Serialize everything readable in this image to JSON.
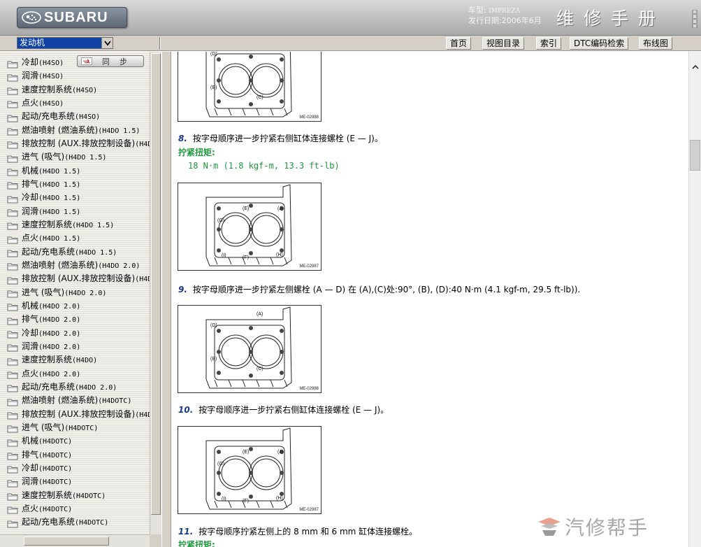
{
  "header": {
    "brand": "SUBARU",
    "model_label": "车型:",
    "model_value": "IMPREZA",
    "date_label": "发行日期:",
    "date_value": "2006年6月",
    "title": "维修手册"
  },
  "toolbar": {
    "section_selected": "发动机",
    "buttons": [
      "首页",
      "视图目录",
      "索引",
      "DTC编码检索",
      "布线图"
    ]
  },
  "sidebar": {
    "sync_label": "同步",
    "items": [
      {
        "name": "冷却",
        "code": "(H4SO)"
      },
      {
        "name": "润滑",
        "code": "(H4SO)"
      },
      {
        "name": "速度控制系统",
        "code": "(H4SO)"
      },
      {
        "name": "点火",
        "code": "(H4SO)"
      },
      {
        "name": "起动/充电系统",
        "code": "(H4SO)"
      },
      {
        "name": "燃油喷射 (燃油系统)",
        "code": "(H4DO 1.5)"
      },
      {
        "name": "排放控制 (AUX.排放控制设备)",
        "code": "(H4D"
      },
      {
        "name": "进气 (吸气)",
        "code": "(H4DO 1.5)"
      },
      {
        "name": "机械",
        "code": "(H4DO 1.5)"
      },
      {
        "name": "排气",
        "code": "(H4DO 1.5)"
      },
      {
        "name": "冷却",
        "code": "(H4DO 1.5)"
      },
      {
        "name": "润滑",
        "code": "(H4DO 1.5)"
      },
      {
        "name": "速度控制系统",
        "code": "(H4DO 1.5)"
      },
      {
        "name": "点火",
        "code": "(H4DO 1.5)"
      },
      {
        "name": "起动/充电系统",
        "code": "(H4DO 1.5)"
      },
      {
        "name": "燃油喷射 (燃油系统)",
        "code": "(H4DO 2.0)"
      },
      {
        "name": "排放控制 (AUX.排放控制设备)",
        "code": "(H4D"
      },
      {
        "name": "进气 (吸气)",
        "code": "(H4DO 2.0)"
      },
      {
        "name": "机械",
        "code": "(H4DO 2.0)"
      },
      {
        "name": "排气",
        "code": "(H4DO 2.0)"
      },
      {
        "name": "冷却",
        "code": "(H4DO 2.0)"
      },
      {
        "name": "润滑",
        "code": "(H4DO 2.0)"
      },
      {
        "name": "速度控制系统",
        "code": "(H4DO)"
      },
      {
        "name": "点火",
        "code": "(H4DO 2.0)"
      },
      {
        "name": "起动/充电系统",
        "code": "(H4DO 2.0)"
      },
      {
        "name": "燃油喷射 (燃油系统)",
        "code": "(H4DOTC)"
      },
      {
        "name": "排放控制 (AUX.排放控制设备)",
        "code": "(H4D"
      },
      {
        "name": "进气 (吸气)",
        "code": "(H4DOTC)"
      },
      {
        "name": "机械",
        "code": "(H4DOTC)"
      },
      {
        "name": "排气",
        "code": "(H4DOTC)"
      },
      {
        "name": "冷却",
        "code": "(H4DOTC)"
      },
      {
        "name": "润滑",
        "code": "(H4DOTC)"
      },
      {
        "name": "速度控制系统",
        "code": "(H4DOTC)"
      },
      {
        "name": "点火",
        "code": "(H4DOTC)"
      },
      {
        "name": "起动/充电系统",
        "code": "(H4DOTC)"
      }
    ]
  },
  "content": {
    "figures": [
      {
        "id": "ME-02988",
        "labels": [
          "(A)",
          "(D)",
          "(B)",
          "(C)"
        ]
      },
      {
        "id": "ME-02987",
        "labels": [
          "(E)",
          "(J)",
          "(G)",
          "(I)",
          "(F)",
          "(H)"
        ]
      },
      {
        "id": "ME-02988",
        "labels": [
          "(A)",
          "(D)",
          "(B)",
          "(C)"
        ]
      },
      {
        "id": "ME-02987",
        "labels": [
          "(E)",
          "(J)",
          "(G)",
          "(I)",
          "(F)",
          "(H)"
        ]
      }
    ],
    "steps": [
      {
        "num": "8.",
        "text": "按字母顺序进一步拧紧右侧缸体连接螺栓 (E — J)。"
      },
      {
        "num": "9.",
        "text": "按字母顺序进一步拧紧左侧螺栓 (A — D) 在 (A),(C)处:90°, (B), (D):40 N·m (4.1 kgf-m, 29.5 ft-lb))."
      },
      {
        "num": "10.",
        "text": "按字母顺序进一步拧紧右侧缸体连接螺栓 (E — J)。"
      },
      {
        "num": "11.",
        "text": "按字母顺序拧紧左侧上的 8 mm 和 6 mm 缸体连接螺栓。"
      }
    ],
    "torque_label": "拧紧扭矩:",
    "torque_value": "18 N·m (1.8 kgf-m, 13.3 ft-lb)",
    "torque_label_2": "拧紧扭矩:"
  },
  "watermark": {
    "text": "汽修帮手"
  },
  "icons": {
    "folder": "folder-icon",
    "sync": "sync-icon",
    "dropdown": "chevron-down-icon",
    "scroll_up": "chevron-up-icon"
  },
  "colors": {
    "selection": "#1042a5",
    "torque_green": "#1d9a3c",
    "step_number": "#1a3a8a"
  }
}
